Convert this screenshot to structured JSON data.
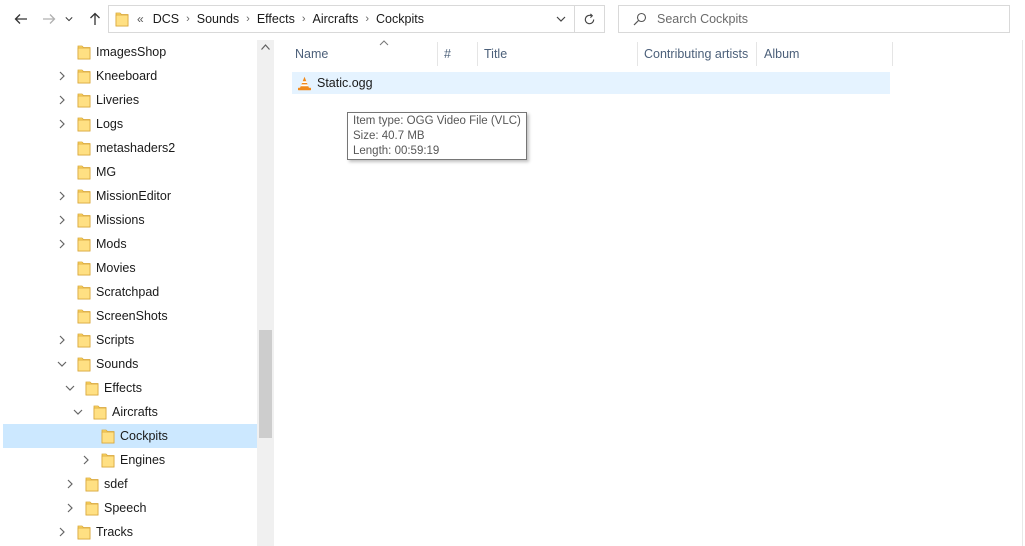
{
  "address": {
    "overflow": "«",
    "crumbs": [
      "DCS",
      "Sounds",
      "Effects",
      "Aircrafts",
      "Cockpits"
    ]
  },
  "search": {
    "placeholder": "Search Cockpits"
  },
  "tree": {
    "items": [
      {
        "label": "ImagesShop",
        "level": 0,
        "expander": "none"
      },
      {
        "label": "Kneeboard",
        "level": 0,
        "expander": "collapsed"
      },
      {
        "label": "Liveries",
        "level": 0,
        "expander": "collapsed"
      },
      {
        "label": "Logs",
        "level": 0,
        "expander": "collapsed"
      },
      {
        "label": "metashaders2",
        "level": 0,
        "expander": "none"
      },
      {
        "label": "MG",
        "level": 0,
        "expander": "none"
      },
      {
        "label": "MissionEditor",
        "level": 0,
        "expander": "collapsed"
      },
      {
        "label": "Missions",
        "level": 0,
        "expander": "collapsed"
      },
      {
        "label": "Mods",
        "level": 0,
        "expander": "collapsed"
      },
      {
        "label": "Movies",
        "level": 0,
        "expander": "none"
      },
      {
        "label": "Scratchpad",
        "level": 0,
        "expander": "none"
      },
      {
        "label": "ScreenShots",
        "level": 0,
        "expander": "none"
      },
      {
        "label": "Scripts",
        "level": 0,
        "expander": "collapsed"
      },
      {
        "label": "Sounds",
        "level": 0,
        "expander": "expanded"
      },
      {
        "label": "Effects",
        "level": 1,
        "expander": "expanded"
      },
      {
        "label": "Aircrafts",
        "level": 2,
        "expander": "expanded"
      },
      {
        "label": "Cockpits",
        "level": 3,
        "expander": "none",
        "selected": true
      },
      {
        "label": "Engines",
        "level": 3,
        "expander": "collapsed"
      },
      {
        "label": "sdef",
        "level": 1,
        "expander": "collapsed"
      },
      {
        "label": "Speech",
        "level": 1,
        "expander": "collapsed"
      },
      {
        "label": "Tracks",
        "level": 0,
        "expander": "collapsed"
      }
    ]
  },
  "columns": {
    "name": "Name",
    "number": "#",
    "title": "Title",
    "artists": "Contributing artists",
    "album": "Album"
  },
  "files": [
    {
      "name": "Static.ogg",
      "icon": "vlc-cone-icon"
    }
  ],
  "tooltip": {
    "type": "Item type: OGG Video File (VLC)",
    "size": "Size: 40.7 MB",
    "length": "Length: 00:59:19"
  },
  "colors": {
    "selection": "#cce8ff",
    "hover": "#e5f3ff",
    "folder": "#ffd966",
    "header_text": "#4c607a"
  }
}
